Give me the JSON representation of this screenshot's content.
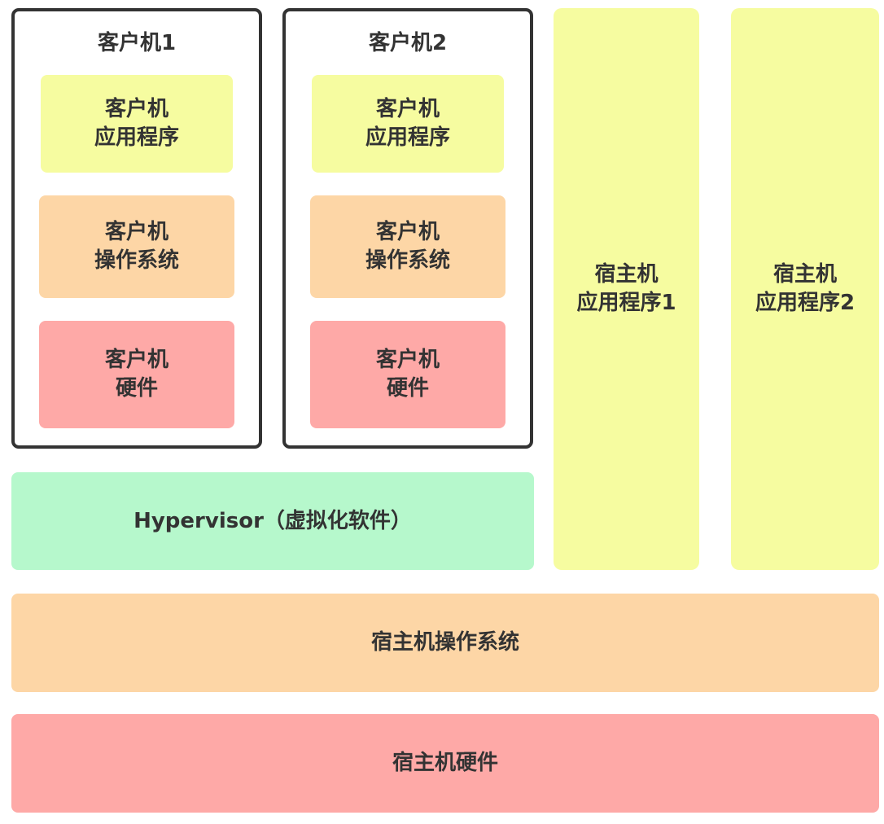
{
  "guests": [
    {
      "title": "客户机1",
      "app": [
        "客户机",
        "应用程序"
      ],
      "os": [
        "客户机",
        "操作系统"
      ],
      "hardware": [
        "客户机",
        "硬件"
      ]
    },
    {
      "title": "客户机2",
      "app": [
        "客户机",
        "应用程序"
      ],
      "os": [
        "客户机",
        "操作系统"
      ],
      "hardware": [
        "客户机",
        "硬件"
      ]
    }
  ],
  "host_apps": [
    [
      "宿主机",
      "应用程序1"
    ],
    [
      "宿主机",
      "应用程序2"
    ]
  ],
  "hypervisor": "Hypervisor（虚拟化软件）",
  "host_os": "宿主机操作系统",
  "host_hardware": "宿主机硬件",
  "colors": {
    "app": "#f6fca0",
    "os": "#fdd6a6",
    "hardware": "#fea9a7",
    "hypervisor": "#b6f8cc",
    "border": "#333333"
  }
}
